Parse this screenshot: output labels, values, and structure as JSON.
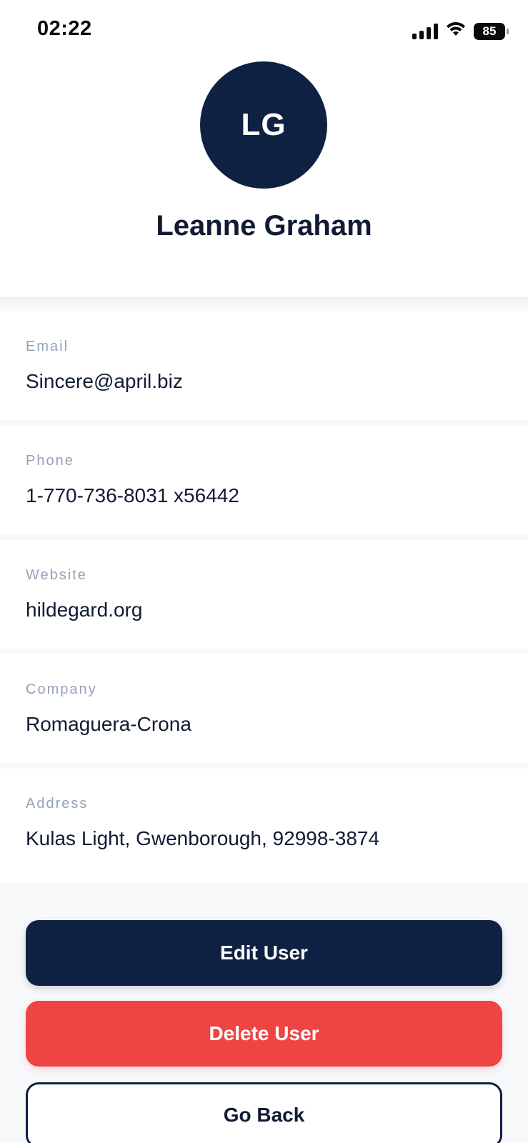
{
  "status_bar": {
    "time": "02:22",
    "battery": "85",
    "icons": [
      "signal-icon",
      "wifi-icon",
      "battery-icon"
    ]
  },
  "profile": {
    "initials": "LG",
    "name": "Leanne Graham",
    "avatar_color": "#0f2142"
  },
  "fields": [
    {
      "label": "Email",
      "value": "Sincere@april.biz"
    },
    {
      "label": "Phone",
      "value": "1-770-736-8031 x56442"
    },
    {
      "label": "Website",
      "value": "hildegard.org"
    },
    {
      "label": "Company",
      "value": "Romaguera-Crona"
    },
    {
      "label": "Address",
      "value": "Kulas Light, Gwenborough, 92998-3874"
    }
  ],
  "actions": {
    "edit_label": "Edit User",
    "delete_label": "Delete User",
    "back_label": "Go Back"
  },
  "colors": {
    "primary": "#0f2142",
    "danger": "#ef4444",
    "label": "#94a1b6",
    "background": "#f6f8fa"
  }
}
